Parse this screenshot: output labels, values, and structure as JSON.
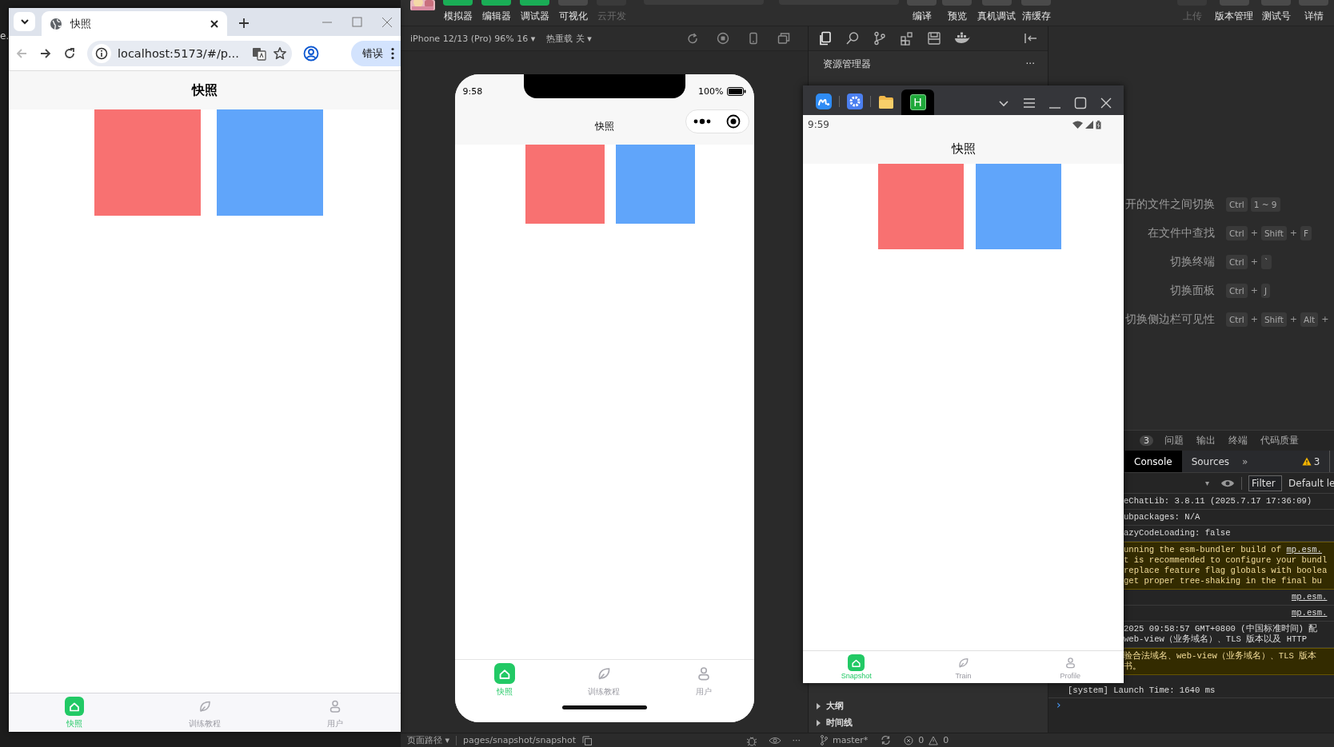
{
  "desktop": {
    "edge_text": "e."
  },
  "browser": {
    "tab_title": "快照",
    "back": {
      "disabled": true
    },
    "address": "localhost:5173/#/p...",
    "error_button": "错误",
    "page": {
      "title": "快照",
      "squares": [
        {
          "color": "#f87171"
        },
        {
          "color": "#60a5fa"
        }
      ],
      "tabbar": [
        {
          "label": "快照",
          "selected": true
        },
        {
          "label": "训练教程",
          "selected": false
        },
        {
          "label": "用户",
          "selected": false
        }
      ]
    }
  },
  "ide": {
    "toolbar": {
      "left": [
        {
          "label": "模拟器",
          "active": true,
          "disabled": false
        },
        {
          "label": "编辑器",
          "active": true,
          "disabled": false
        },
        {
          "label": "调试器",
          "active": true,
          "disabled": false
        },
        {
          "label": "可视化",
          "active": false,
          "disabled": false
        },
        {
          "label": "云开发",
          "active": false,
          "disabled": true
        }
      ],
      "center": [
        {
          "label": "编译",
          "disabled": false
        },
        {
          "label": "预览",
          "disabled": false
        },
        {
          "label": "真机调试",
          "disabled": false
        },
        {
          "label": "清缓存",
          "disabled": false
        }
      ],
      "right": [
        {
          "label": "上传",
          "disabled": true
        },
        {
          "label": "版本管理",
          "disabled": false
        },
        {
          "label": "测试号",
          "disabled": false
        },
        {
          "label": "详情",
          "disabled": false
        }
      ]
    },
    "simulator": {
      "device": "iPhone 12/13 (Pro) 96% 16 ▾",
      "hot_reload": "热重载 关 ▾",
      "phone": {
        "time": "9:58",
        "battery": "100%",
        "title": "快照",
        "squares": [
          {
            "color": "#f87171"
          },
          {
            "color": "#60a5fa"
          }
        ],
        "tabbar": [
          {
            "label": "快照",
            "selected": true
          },
          {
            "label": "训练教程",
            "selected": false
          },
          {
            "label": "用户",
            "selected": false
          }
        ]
      }
    },
    "explorer": {
      "title": "资源管理器",
      "menu": "···",
      "sections": [
        {
          "label": "大纲",
          "expanded": false
        },
        {
          "label": "时间线",
          "expanded": false
        }
      ]
    },
    "shortcuts": [
      {
        "label": "开的文件之间切换",
        "keys": [
          {
            "kind": "key",
            "text": "Ctrl"
          },
          {
            "kind": "key",
            "text": "1 ~ 9"
          }
        ]
      },
      {
        "label": "在文件中查找",
        "keys": [
          {
            "kind": "key",
            "text": "Ctrl"
          },
          {
            "kind": "plus",
            "text": "+"
          },
          {
            "kind": "key",
            "text": "Shift"
          },
          {
            "kind": "plus",
            "text": "+"
          },
          {
            "kind": "key",
            "text": "F"
          }
        ]
      },
      {
        "label": "切换终端",
        "keys": [
          {
            "kind": "key",
            "text": "Ctrl"
          },
          {
            "kind": "plus",
            "text": "+"
          },
          {
            "kind": "key",
            "text": "`"
          }
        ]
      },
      {
        "label": "切换面板",
        "keys": [
          {
            "kind": "key",
            "text": "Ctrl"
          },
          {
            "kind": "plus",
            "text": "+"
          },
          {
            "kind": "key",
            "text": "J"
          }
        ]
      },
      {
        "label": "切换侧边栏可见性",
        "keys": [
          {
            "kind": "key",
            "text": "Ctrl"
          },
          {
            "kind": "plus",
            "text": "+"
          },
          {
            "kind": "key",
            "text": "Shift"
          },
          {
            "kind": "plus",
            "text": "+"
          },
          {
            "kind": "key",
            "text": "Alt"
          },
          {
            "kind": "plus",
            "text": "+"
          }
        ]
      }
    ],
    "panel": {
      "badge": "3",
      "tabs": [
        "问题",
        "输出",
        "终端",
        "代码质量"
      ],
      "devtools_tabs": [
        {
          "label": "Console",
          "selected": true
        },
        {
          "label": "Sources",
          "selected": false
        }
      ],
      "more": "»",
      "warnings": "3",
      "dropdown": "▾",
      "filter": {
        "placeholder": "Filter"
      },
      "level_select": "Default le",
      "logs": [
        {
          "kind": "info",
          "lines": [
            {
              "text": "eChatLib: 3.8.11 (2025.7.17 17:36:09)"
            }
          ]
        },
        {
          "kind": "info",
          "lines": [
            {
              "text": "ubpackages: N/A"
            }
          ]
        },
        {
          "kind": "info",
          "lines": [
            {
              "text": "azyCodeLoading: false"
            }
          ]
        },
        {
          "kind": "warning",
          "lines": [
            {
              "text": "unning the esm-bundler build of ",
              "link": "mp.esm."
            },
            {
              "text": "t is recommended to configure your bundl"
            },
            {
              "text": "replace feature flag globals with boolea"
            },
            {
              "text": "get proper tree-shaking in the final bu"
            }
          ]
        },
        {
          "kind": "source",
          "lines": [
            {
              "link": "mp.esm."
            }
          ]
        },
        {
          "kind": "source",
          "lines": [
            {
              "link": "mp.esm."
            }
          ]
        },
        {
          "kind": "info",
          "lines": [
            {
              "text": "2025 09:58:57 GMT+0800 (中国标准时间) 配"
            },
            {
              "text": "web-view（业务域名）、TLS 版本以及 HTTP"
            }
          ]
        },
        {
          "kind": "warning",
          "lines": [
            {
              "text": "验合法域名、web-view（业务域名）、TLS 版本"
            },
            {
              "text": "书。"
            }
          ]
        }
      ],
      "tail": "[system] Launch Time: 1640 ms",
      "prompt": "›"
    },
    "status_bar": {
      "page_path": "页面路径 ▾",
      "path": "pages/snapshot/snapshot",
      "more": "···",
      "branch": "master*",
      "errors": "0",
      "warnings": "0"
    }
  },
  "emulator": {
    "badge": "H",
    "time": "9:59",
    "title": "快照",
    "squares": [
      {
        "color": "#f87171"
      },
      {
        "color": "#60a5fa"
      }
    ],
    "tabbar": [
      {
        "label": "Snapshot",
        "selected": true
      },
      {
        "label": "Train",
        "selected": false
      },
      {
        "label": "Profile",
        "selected": false
      }
    ]
  }
}
